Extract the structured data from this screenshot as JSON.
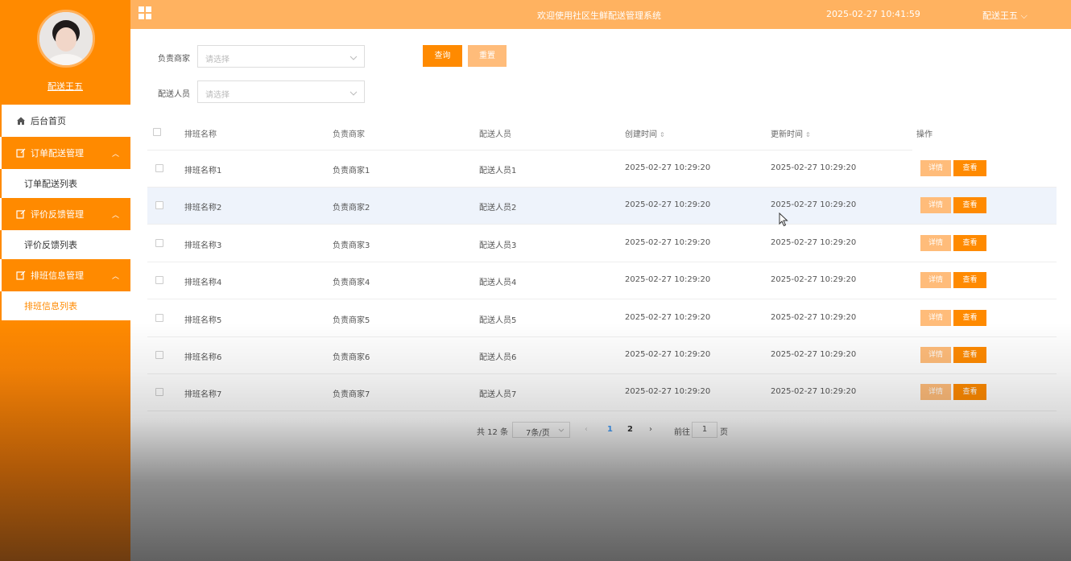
{
  "sidebar": {
    "username": "配送王五",
    "menu": [
      {
        "label": "后台首页"
      },
      {
        "label": "订单配送管理",
        "sub": "订单配送列表"
      },
      {
        "label": "评价反馈管理",
        "sub": "评价反馈列表"
      },
      {
        "label": "排班信息管理",
        "sub": "排班信息列表"
      }
    ]
  },
  "header": {
    "title": "欢迎使用社区生鲜配送管理系统",
    "datetime": "2025-02-27 10:41:59",
    "user": "配送王五"
  },
  "filters": {
    "merchant_label": "负责商家",
    "merchant_placeholder": "请选择",
    "courier_label": "配送人员",
    "courier_placeholder": "请选择",
    "query_label": "查询",
    "reset_label": "重置"
  },
  "table": {
    "headers": [
      "排班名称",
      "负责商家",
      "配送人员",
      "创建时间",
      "更新时间",
      "操作"
    ],
    "rows": [
      {
        "name": "排班名称1",
        "merchant": "负责商家1",
        "courier": "配送人员1",
        "created": "2025-02-27 10:29:20",
        "updated": "2025-02-27 10:29:20"
      },
      {
        "name": "排班名称2",
        "merchant": "负责商家2",
        "courier": "配送人员2",
        "created": "2025-02-27 10:29:20",
        "updated": "2025-02-27 10:29:20"
      },
      {
        "name": "排班名称3",
        "merchant": "负责商家3",
        "courier": "配送人员3",
        "created": "2025-02-27 10:29:20",
        "updated": "2025-02-27 10:29:20"
      },
      {
        "name": "排班名称4",
        "merchant": "负责商家4",
        "courier": "配送人员4",
        "created": "2025-02-27 10:29:20",
        "updated": "2025-02-27 10:29:20"
      },
      {
        "name": "排班名称5",
        "merchant": "负责商家5",
        "courier": "配送人员5",
        "created": "2025-02-27 10:29:20",
        "updated": "2025-02-27 10:29:20"
      },
      {
        "name": "排班名称6",
        "merchant": "负责商家6",
        "courier": "配送人员6",
        "created": "2025-02-27 10:29:20",
        "updated": "2025-02-27 10:29:20"
      },
      {
        "name": "排班名称7",
        "merchant": "负责商家7",
        "courier": "配送人员7",
        "created": "2025-02-27 10:29:20",
        "updated": "2025-02-27 10:29:20"
      }
    ],
    "detail_label": "详情",
    "view_label": "查看"
  },
  "pagination": {
    "total": "共 12 条",
    "page_size": "7条/页",
    "pages": [
      "1",
      "2"
    ],
    "current_page": "1",
    "goto_label": "前往",
    "goto_value": "1",
    "page_suffix": "页"
  },
  "colors": {
    "accent": "#ff8a00",
    "header": "#ffb260",
    "light_button": "#ffbc7a"
  }
}
